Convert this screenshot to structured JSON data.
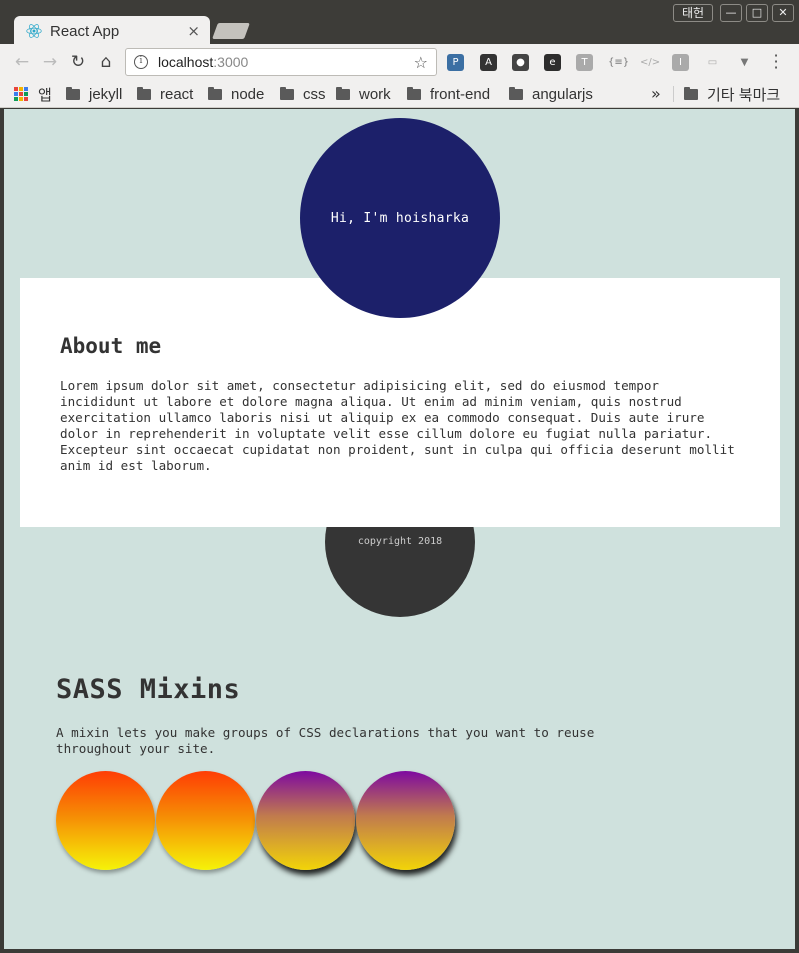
{
  "browser": {
    "tab_title": "React App",
    "tab_close": "×",
    "user_label": "태헌",
    "url_host": "localhost",
    "url_port": ":3000",
    "bookmarks": [
      {
        "label": "앱",
        "type": "apps"
      },
      {
        "label": "jekyll",
        "type": "folder"
      },
      {
        "label": "react",
        "type": "folder"
      },
      {
        "label": "node",
        "type": "folder"
      },
      {
        "label": "css",
        "type": "folder"
      },
      {
        "label": "work",
        "type": "folder"
      },
      {
        "label": "front-end",
        "type": "folder"
      },
      {
        "label": "angularjs",
        "type": "folder"
      }
    ],
    "bookmarks_overflow": "»",
    "other_bookmarks": "기타 북마크"
  },
  "page": {
    "header_text": "Hi, I'm hoisharka",
    "about_title": "About me",
    "about_text": "Lorem ipsum dolor sit amet, consectetur adipisicing elit, sed do eiusmod tempor incididunt ut labore et dolore magna aliqua. Ut enim ad minim veniam, quis nostrud exercitation ullamco laboris nisi ut aliquip ex ea commodo consequat. Duis aute irure dolor in reprehenderit in voluptate velit esse cillum dolore eu fugiat nulla pariatur. Excepteur sint occaecat cupidatat non proident, sunt in culpa qui officia deserunt mollit anim id est laborum.",
    "footer_text": "copyright 2018",
    "mixins_title": "SASS Mixins",
    "mixins_text": "A mixin lets you make groups of CSS declarations that you want to reuse throughout your site.",
    "balls": [
      "orange-yellow",
      "orange-yellow",
      "purple-gold",
      "purple-gold"
    ]
  },
  "colors": {
    "page_bg": "#cfe1dd",
    "header_circle": "#1c206a",
    "footer_circle": "#353535"
  }
}
